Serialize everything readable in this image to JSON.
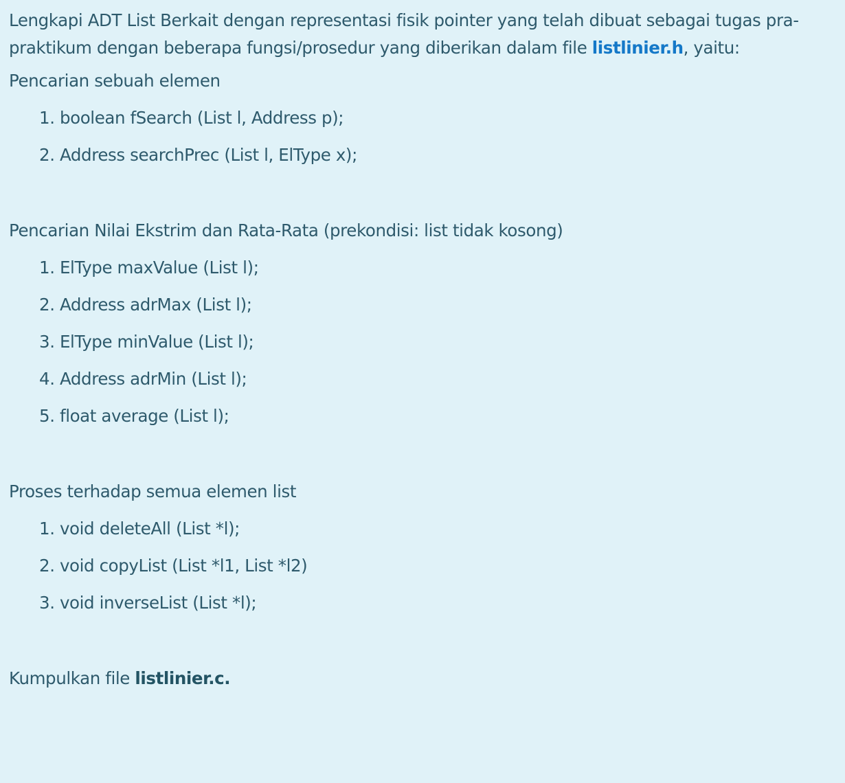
{
  "intro": {
    "text_before": "Lengkapi ADT List Berkait dengan representasi fisik pointer yang telah dibuat sebagai tugas pra-praktikum dengan beberapa fungsi/prosedur yang diberikan dalam file ",
    "file_link": "listlinier.h",
    "text_after": ", yaitu:"
  },
  "sections": [
    {
      "heading": "Pencarian sebuah elemen",
      "items": [
        "1. boolean fSearch (List l, Address p);",
        "2. Address searchPrec (List l, ElType x);"
      ]
    },
    {
      "heading": "Pencarian Nilai Ekstrim dan Rata-Rata (prekondisi: list tidak kosong)",
      "items": [
        "1. ElType maxValue (List l);",
        "2. Address adrMax (List l);",
        "3. ElType minValue (List l);",
        "4. Address adrMin (List l);",
        "5. float average (List l);"
      ]
    },
    {
      "heading": "Proses terhadap semua elemen list",
      "items": [
        "1. void deleteAll (List *l);",
        "2. void copyList (List *l1, List *l2)",
        "3. void inverseList (List *l);"
      ]
    }
  ],
  "footer": {
    "text_before": "Kumpulkan file ",
    "file_name": "listlinier.c."
  },
  "colors": {
    "background": "#e0f2f8",
    "text": "#2e5a6c",
    "link": "#1478c8"
  }
}
